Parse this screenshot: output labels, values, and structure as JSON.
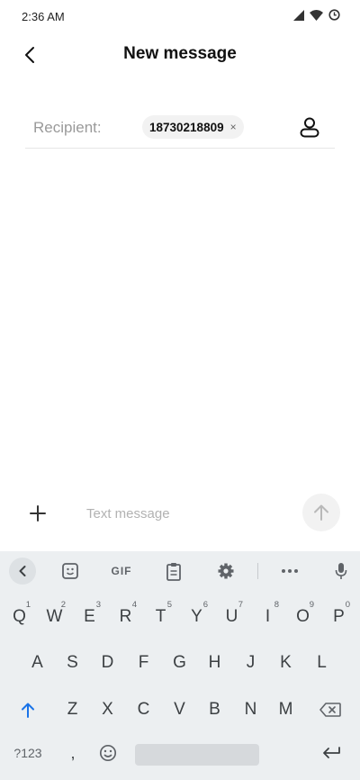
{
  "status_bar": {
    "time": "2:36 AM"
  },
  "header": {
    "title": "New message"
  },
  "recipient": {
    "label": "Recipient:",
    "chip": "18730218809",
    "chip_close": "×"
  },
  "compose": {
    "placeholder": "Text message",
    "value": ""
  },
  "keyboard": {
    "toolbar": {
      "gif_label": "GIF"
    },
    "row1": [
      {
        "key": "Q",
        "hint": "1"
      },
      {
        "key": "W",
        "hint": "2"
      },
      {
        "key": "E",
        "hint": "3"
      },
      {
        "key": "R",
        "hint": "4"
      },
      {
        "key": "T",
        "hint": "5"
      },
      {
        "key": "Y",
        "hint": "6"
      },
      {
        "key": "U",
        "hint": "7"
      },
      {
        "key": "I",
        "hint": "8"
      },
      {
        "key": "O",
        "hint": "9"
      },
      {
        "key": "P",
        "hint": "0"
      }
    ],
    "row2": [
      "A",
      "S",
      "D",
      "F",
      "G",
      "H",
      "J",
      "K",
      "L"
    ],
    "row3": [
      "Z",
      "X",
      "C",
      "V",
      "B",
      "N",
      "M"
    ],
    "row4": {
      "symbols": "?123",
      "comma": ","
    },
    "colors": {
      "shift_accent": "#1a73e8",
      "background": "#eceff1"
    }
  }
}
